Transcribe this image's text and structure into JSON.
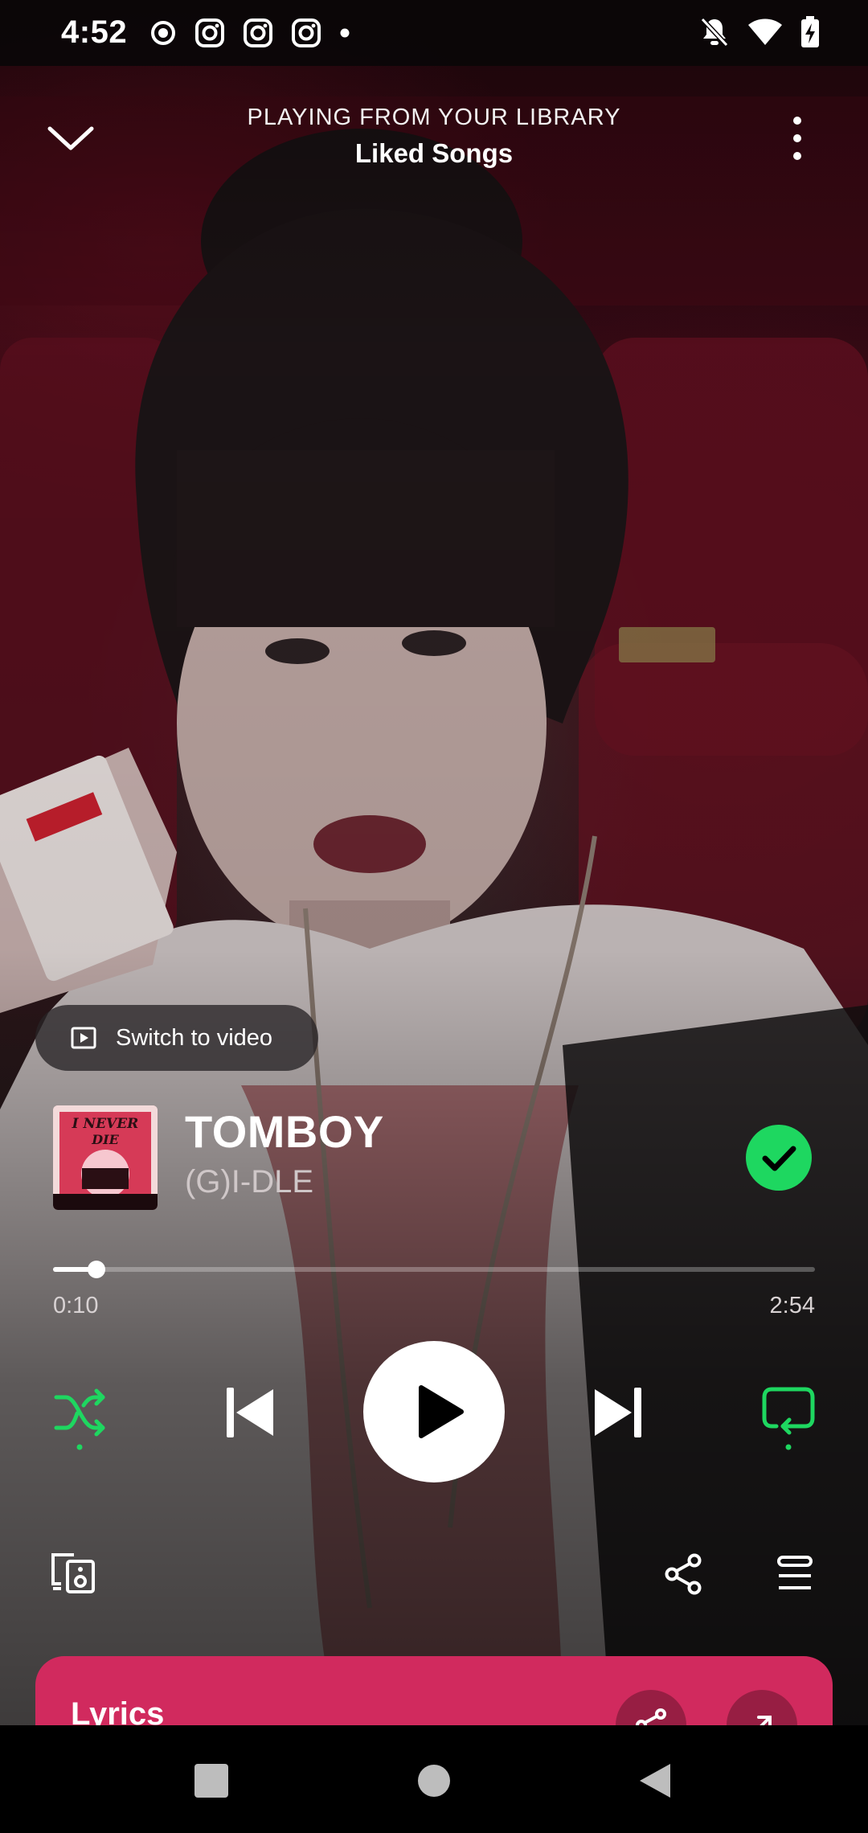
{
  "status_bar": {
    "time": "4:52",
    "left_icons": [
      "record-icon",
      "instagram-icon",
      "instagram-icon",
      "instagram-icon",
      "dot-icon"
    ],
    "right_icons": [
      "bell-off-icon",
      "wifi-icon",
      "battery-charging-icon"
    ]
  },
  "header": {
    "context": "PLAYING FROM YOUR LIBRARY",
    "title": "Liked Songs"
  },
  "switch_video": {
    "label": "Switch to video"
  },
  "track": {
    "cover_text": "I NEVER DIE",
    "title": "TOMBOY",
    "artist": "(G)I-DLE",
    "liked": true
  },
  "progress": {
    "elapsed": "0:10",
    "total": "2:54",
    "fraction": 0.057
  },
  "controls": {
    "shuffle_active": true,
    "repeat_active": true,
    "state": "paused"
  },
  "lyrics": {
    "label": "Lyrics"
  },
  "colors": {
    "accent_green": "#1ed760",
    "lyrics_card": "#d12a5e"
  }
}
